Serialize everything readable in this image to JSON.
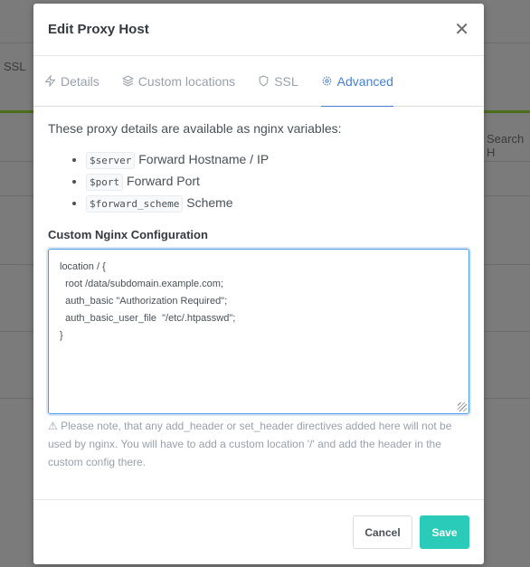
{
  "background": {
    "ssl_tab": "SSL",
    "search_placeholder": "Search H"
  },
  "modal": {
    "title": "Edit Proxy Host",
    "tabs": [
      {
        "label": "Details",
        "icon": "zap-icon"
      },
      {
        "label": "Custom locations",
        "icon": "layers-icon"
      },
      {
        "label": "SSL",
        "icon": "shield-icon"
      },
      {
        "label": "Advanced",
        "icon": "gear-icon",
        "active": true
      }
    ],
    "intro": "These proxy details are available as nginx variables:",
    "variables": [
      {
        "code": "$server",
        "desc": "Forward Hostname / IP"
      },
      {
        "code": "$port",
        "desc": "Forward Port"
      },
      {
        "code": "$forward_scheme",
        "desc": "Scheme"
      }
    ],
    "config_label": "Custom Nginx Configuration",
    "config_value": "location / {\n  root /data/subdomain.example.com;\n  auth_basic \"Authorization Required\";\n  auth_basic_user_file  \"/etc/.htpasswd\";\n}",
    "note": "Please note, that any add_header or set_header directives added here will not be used by nginx. You will have to add a custom location '/' and add the header in the custom config there.",
    "cancel_label": "Cancel",
    "save_label": "Save",
    "colors": {
      "accent": "#467fcf",
      "save": "#2bcbba"
    }
  }
}
